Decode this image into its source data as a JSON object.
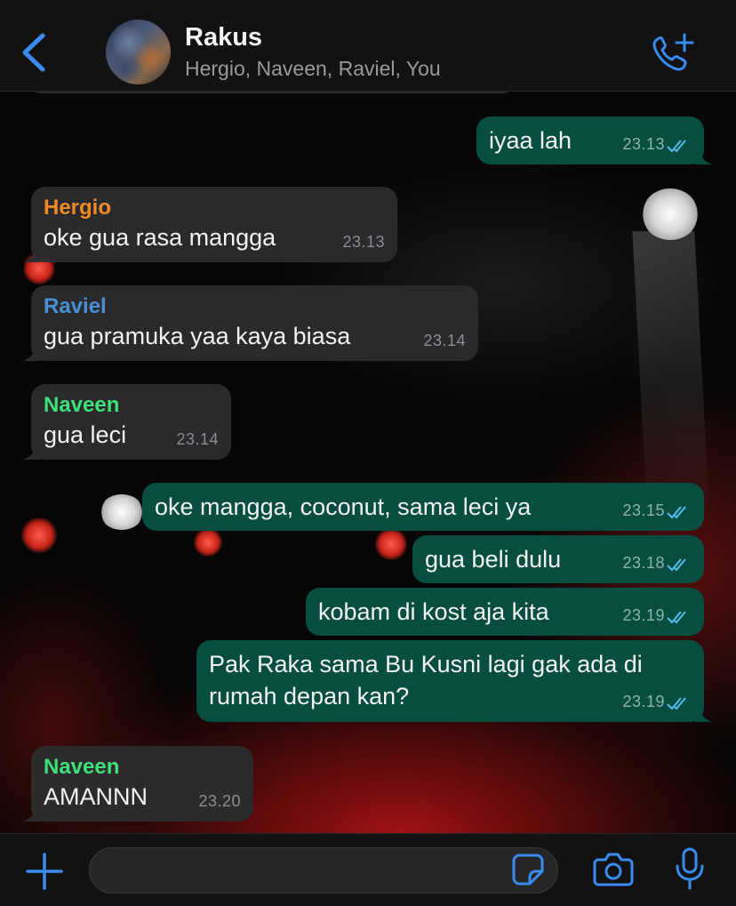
{
  "header": {
    "back_icon": "chevron-left-icon",
    "chat_title": "Rakus",
    "participants": "Hergio, Naveen, Raviel, You",
    "call_icon": "add-call-icon"
  },
  "colors": {
    "accent": "#3b8cf0",
    "outgoing_bubble": "#074d40",
    "incoming_bubble": "#2c2c2e",
    "hergio": "#f08a24",
    "raviel": "#4a8fd6",
    "naveen": "#3ee07a",
    "read_ticks": "#53bdeb"
  },
  "messages": [
    {
      "direction": "out",
      "text": "iyaa lah",
      "time": "23.13",
      "status": "read"
    },
    {
      "direction": "in",
      "sender": "Hergio",
      "text": "oke gua rasa mangga",
      "time": "23.13"
    },
    {
      "direction": "in",
      "sender": "Raviel",
      "text": "gua pramuka yaa kaya biasa",
      "time": "23.14"
    },
    {
      "direction": "in",
      "sender": "Naveen",
      "text": "gua leci",
      "time": "23.14"
    },
    {
      "direction": "out",
      "text": "oke mangga, coconut, sama leci ya",
      "time": "23.15",
      "status": "read"
    },
    {
      "direction": "out",
      "text": "gua beli dulu",
      "time": "23.18",
      "status": "read"
    },
    {
      "direction": "out",
      "text": "kobam di kost aja kita",
      "time": "23.19",
      "status": "read"
    },
    {
      "direction": "out",
      "text_line1": "Pak Raka sama Bu Kusni lagi gak ada di",
      "text_line2": "rumah depan kan?",
      "time": "23.19",
      "status": "read"
    },
    {
      "direction": "in",
      "sender": "Naveen",
      "text": "AMANNN",
      "time": "23.20"
    }
  ],
  "input": {
    "placeholder": "",
    "plus_icon": "plus-icon",
    "sticker_icon": "sticker-icon",
    "camera_icon": "camera-icon",
    "mic_icon": "microphone-icon"
  }
}
